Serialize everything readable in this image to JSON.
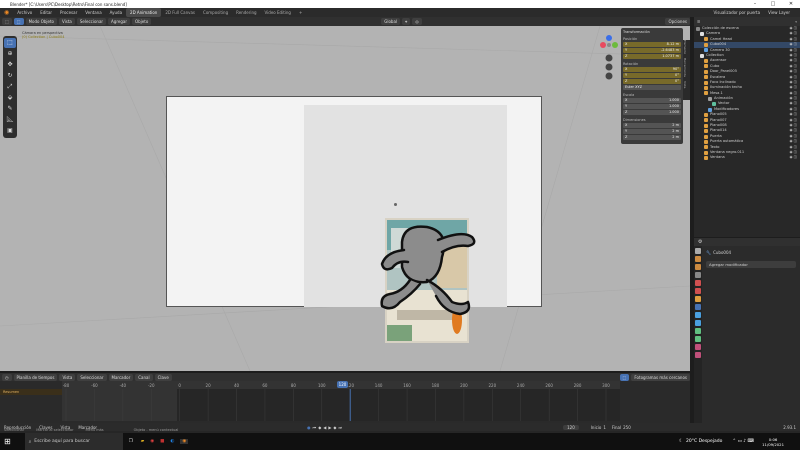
{
  "window": {
    "title": "Blender* [C:\\Users\\PC\\Desktop\\Retro\\Final con sans.blend]",
    "minimize": "–",
    "maximize": "□",
    "close": "✕"
  },
  "menu": [
    "Archivo",
    "Editar",
    "Procesar",
    "Ventana",
    "Ayuda"
  ],
  "workspaces": [
    {
      "label": "2D Animation",
      "active": true
    },
    {
      "label": "2D Full Canvas",
      "active": false
    },
    {
      "label": "Compositing",
      "active": false
    },
    {
      "label": "Rendering",
      "active": false
    },
    {
      "label": "Video Editing",
      "active": false
    },
    {
      "label": "+",
      "active": false
    }
  ],
  "top_right": {
    "view_layer": "Visualizador por puerta",
    "layer": "View Layer"
  },
  "viewport_header": {
    "mode": "Modo Objeto",
    "menus": [
      "Vista",
      "Seleccionar",
      "Agregar",
      "Objeto"
    ],
    "transform": "Global",
    "options": "Opciones"
  },
  "viewport_overlay": {
    "line1": "Cámara en perspectiva",
    "line2": "(0) Collection | Cubo004"
  },
  "tools": [
    "cursor",
    "select",
    "move",
    "rotate",
    "scale",
    "transform",
    "annotate",
    "measure",
    "add"
  ],
  "npanel": {
    "title": "Transformación",
    "location_label": "Posición",
    "location": [
      {
        "axis": "X",
        "value": "8.12 m"
      },
      {
        "axis": "Y",
        "value": "-2.6483 m"
      },
      {
        "axis": "Z",
        "value": "1.0737 m"
      }
    ],
    "rotation_label": "Rotación",
    "rotation": [
      {
        "axis": "X",
        "value": "90°"
      },
      {
        "axis": "Y",
        "value": "0°"
      },
      {
        "axis": "Z",
        "value": "0°"
      }
    ],
    "rotation_mode": "Euler XYZ",
    "scale_label": "Escala",
    "scale": [
      {
        "axis": "X",
        "value": "1.000"
      },
      {
        "axis": "Y",
        "value": "1.000"
      },
      {
        "axis": "Z",
        "value": "1.000"
      }
    ],
    "dimensions_label": "Dimensiones",
    "dimensions": [
      {
        "axis": "X",
        "value": "2 m"
      },
      {
        "axis": "Y",
        "value": "2 m"
      },
      {
        "axis": "Z",
        "value": "2 m"
      }
    ]
  },
  "ntabs": [
    "Elemento",
    "Herramienta",
    "Vista"
  ],
  "outliner": {
    "header": "Colección de escena",
    "items": [
      {
        "label": "Colección de escena",
        "indent": 0,
        "color": "#888888"
      },
      {
        "label": "Camera",
        "indent": 1,
        "color": "#e0e0e0"
      },
      {
        "label": "Camel Head",
        "indent": 2,
        "color": "#e0a040"
      },
      {
        "label": "Cubo004",
        "indent": 2,
        "color": "#e0a040"
      },
      {
        "label": "Camera 30",
        "indent": 2,
        "color": "#60a0e0"
      },
      {
        "label": "Collection",
        "indent": 1,
        "color": "#e0e0e0"
      },
      {
        "label": "Ascensor",
        "indent": 2,
        "color": "#e0a040"
      },
      {
        "label": "Cubo",
        "indent": 2,
        "color": "#e0a040"
      },
      {
        "label": "Door_Panel005",
        "indent": 2,
        "color": "#e0a040"
      },
      {
        "label": "Escalera",
        "indent": 2,
        "color": "#e0a040"
      },
      {
        "label": "Foco Inclinado",
        "indent": 2,
        "color": "#e0a040"
      },
      {
        "label": "Iluminación techo",
        "indent": 2,
        "color": "#e0a040"
      },
      {
        "label": "Mesa.1",
        "indent": 2,
        "color": "#e0a040"
      },
      {
        "label": "Animación",
        "indent": 3,
        "color": "#a0a0a0"
      },
      {
        "label": "Vector",
        "indent": 4,
        "color": "#60c0a0"
      },
      {
        "label": "Modificadores",
        "indent": 3,
        "color": "#60a0e0"
      },
      {
        "label": "Plano005",
        "indent": 2,
        "color": "#e0a040"
      },
      {
        "label": "Plano007",
        "indent": 2,
        "color": "#e0a040"
      },
      {
        "label": "Plano008",
        "indent": 2,
        "color": "#e0a040"
      },
      {
        "label": "Plano014",
        "indent": 2,
        "color": "#e0a040"
      },
      {
        "label": "Puerta",
        "indent": 2,
        "color": "#e0a040"
      },
      {
        "label": "Puerta automática",
        "indent": 2,
        "color": "#e0a040"
      },
      {
        "label": "Texto",
        "indent": 2,
        "color": "#e0a040"
      },
      {
        "label": "Ventana negro.011",
        "indent": 2,
        "color": "#e0a040"
      },
      {
        "label": "Ventana",
        "indent": 2,
        "color": "#e0a040"
      }
    ]
  },
  "properties": {
    "object_name": "Cubo004",
    "add_modifier": "Agregar modificador"
  },
  "timeline": {
    "menus": [
      "Reproducción",
      "Claves",
      "Vista",
      "Marcador"
    ],
    "header_menus": [
      "Planilla de tiempos",
      "Vista",
      "Seleccionar",
      "Marcador",
      "Canal",
      "Clave"
    ],
    "summary": "Resumen",
    "current_frame": "120",
    "ticks": [
      "-80",
      "-60",
      "-40",
      "-20",
      "0",
      "20",
      "40",
      "60",
      "80",
      "100",
      "120",
      "140",
      "160",
      "180",
      "200",
      "220",
      "240",
      "260",
      "280",
      "300"
    ],
    "start_label": "Inicio",
    "start": "1",
    "end_label": "Final",
    "end": "250",
    "frame_field": "120",
    "interp": "Fotogramas más cercanos"
  },
  "status": {
    "left": "Seleccionar",
    "mid1": "Marcar al seleccionar",
    "mid2": "Menú más",
    "center": "Objeto - menú contextual",
    "version": "2.93.1"
  },
  "taskbar": {
    "search_placeholder": "Escribe aquí para buscar",
    "weather": "20°C  Despejado",
    "time": "0:06",
    "date": "11/09/2021"
  },
  "colors": {
    "accent": "#4772b3",
    "viewport_bg": "#b3b3b3",
    "playhead": "#4772b3",
    "location_field": "#786a2a"
  }
}
